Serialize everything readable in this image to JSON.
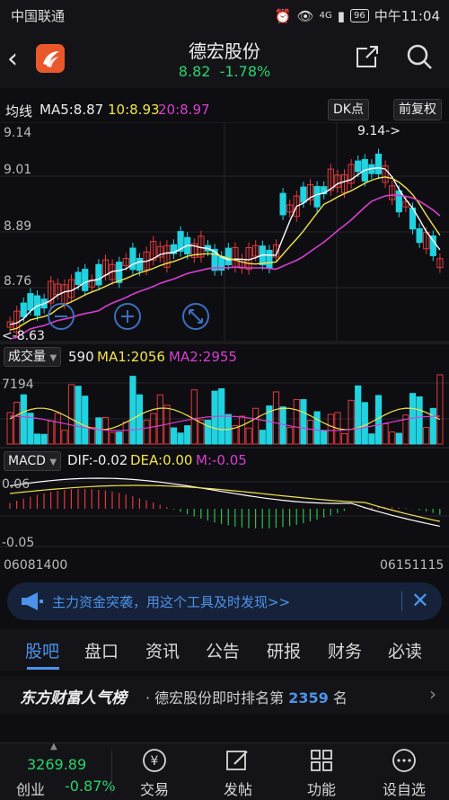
{
  "status": {
    "carrier": "中国联通",
    "network": "4G",
    "battery": "96",
    "time": "中午11:04"
  },
  "header": {
    "back_icon": "back-chevron-icon",
    "title": "德宏股份",
    "price": "8.82",
    "change": "-1.78%"
  },
  "ma_legend": {
    "label": "均线",
    "ma5": "MA5:8.87",
    "ma10": "10:8.93",
    "ma20": "20:8.97",
    "dk_button": "DK点",
    "adjust_button": "前复权",
    "colors": {
      "ma5": "#ffffff",
      "ma10": "#f2e44a",
      "ma20": "#d83fd0",
      "up": "#e23a3a",
      "down": "#21d3e0"
    }
  },
  "kline": {
    "yticks": [
      "9.14",
      "9.01",
      "8.89",
      "8.76"
    ],
    "high_marker": "9.14->",
    "low_marker": "<-8.63"
  },
  "volume": {
    "selector": "成交量",
    "value": "590",
    "ma1": "MA1:2056",
    "ma2": "MA2:2955",
    "ytick": "7194"
  },
  "macd": {
    "selector": "MACD",
    "dif": "DIF:-0.02",
    "dea": "DEA:0.00",
    "m": "M:-0.05",
    "ytick_top": "0.06",
    "ytick_bottom": "-0.05"
  },
  "time_axis": {
    "start": "06081400",
    "end": "06151115"
  },
  "banner": {
    "text": "主力资金突袭，用这个工具及时发现>>"
  },
  "tabs": [
    "股吧",
    "盘口",
    "资讯",
    "公告",
    "研报",
    "财务",
    "必读"
  ],
  "ranking": {
    "brand": "东方财富人气榜",
    "text_before": "· 德宏股份即时排名第",
    "rank": "2359",
    "text_after": "名"
  },
  "bottom_nav": {
    "index_value": "3269.89",
    "index_name": "创业",
    "index_change": "-0.87%",
    "items": [
      "交易",
      "发帖",
      "功能",
      "设自选"
    ]
  }
}
